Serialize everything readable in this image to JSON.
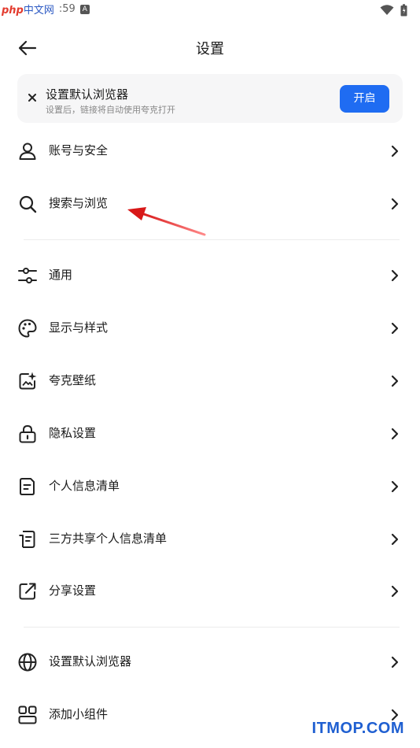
{
  "status_bar": {
    "logo_text": "php",
    "logo_suffix": "中文网",
    "time": ":59",
    "badge": "A"
  },
  "header": {
    "title": "设置"
  },
  "banner": {
    "title": "设置默认浏览器",
    "subtitle": "设置后，链接将自动使用夸克打开",
    "button_label": "开启"
  },
  "sections": [
    {
      "items": [
        {
          "label": "账号与安全",
          "icon": "user-icon"
        },
        {
          "label": "搜索与浏览",
          "icon": "search-icon"
        }
      ]
    },
    {
      "items": [
        {
          "label": "通用",
          "icon": "sliders-icon"
        },
        {
          "label": "显示与样式",
          "icon": "palette-icon"
        },
        {
          "label": "夸克壁纸",
          "icon": "wallpaper-icon"
        },
        {
          "label": "隐私设置",
          "icon": "lock-icon"
        },
        {
          "label": "个人信息清单",
          "icon": "document-icon"
        },
        {
          "label": "三方共享个人信息清单",
          "icon": "shared-document-icon"
        },
        {
          "label": "分享设置",
          "icon": "share-icon"
        }
      ]
    },
    {
      "items": [
        {
          "label": "设置默认浏览器",
          "icon": "globe-icon"
        },
        {
          "label": "添加小组件",
          "icon": "widgets-icon"
        }
      ]
    }
  ],
  "watermark": "ITMOP.COM",
  "colors": {
    "accent": "#1f6cf2",
    "annotation_arrow": "#e02020"
  }
}
